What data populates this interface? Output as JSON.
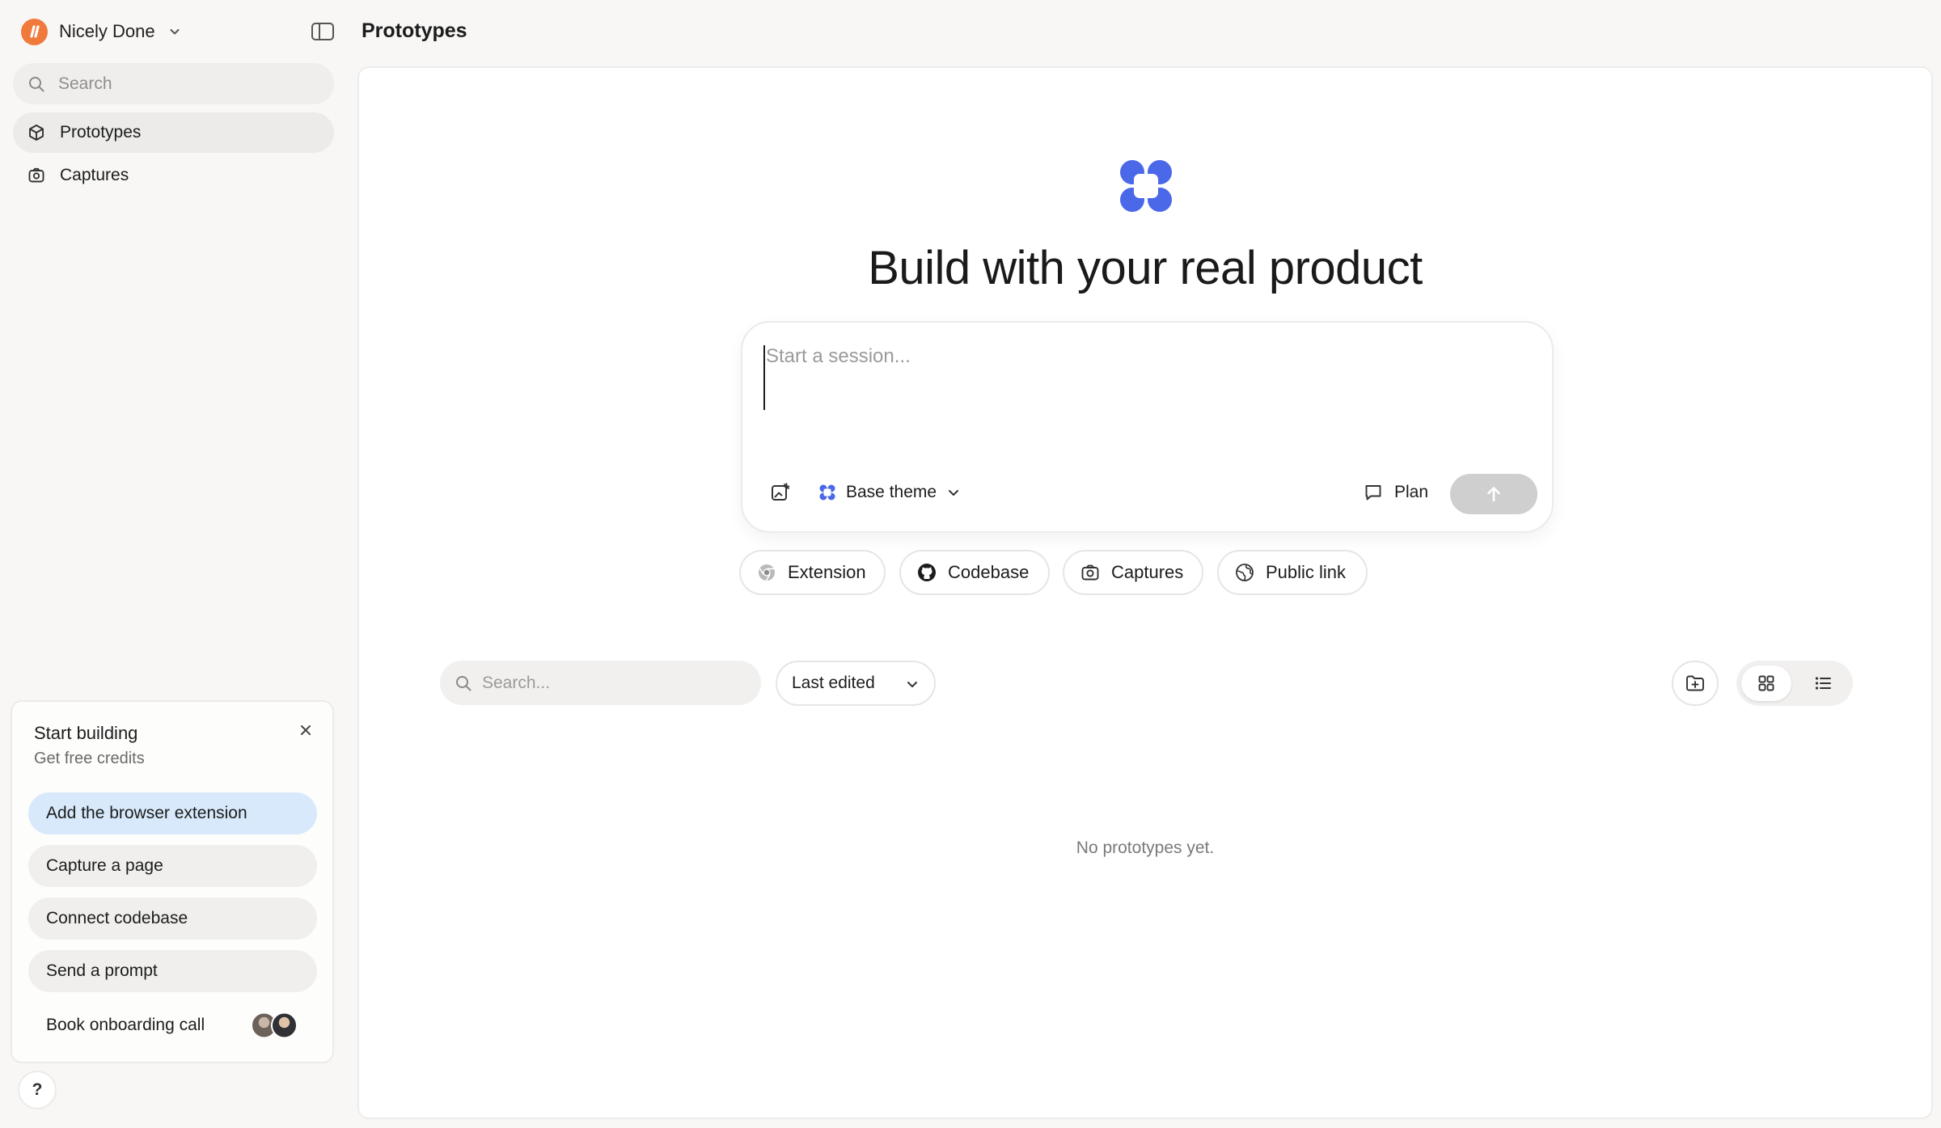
{
  "workspace": {
    "name": "Nicely Done",
    "logo_icon": "workspace-logo-icon",
    "brand_color": "#f07a3b"
  },
  "sidebar": {
    "search": {
      "placeholder": "Search"
    },
    "items": [
      {
        "label": "Prototypes",
        "icon": "cube-icon",
        "active": true
      },
      {
        "label": "Captures",
        "icon": "camera-icon",
        "active": false
      }
    ]
  },
  "onboarding": {
    "title": "Start building",
    "subtitle": "Get free credits",
    "steps": [
      {
        "label": "Add the browser extension"
      },
      {
        "label": "Capture a page"
      },
      {
        "label": "Connect codebase"
      },
      {
        "label": "Send a prompt"
      },
      {
        "label": "Book onboarding call"
      }
    ]
  },
  "help": {
    "label": "?"
  },
  "header": {
    "title": "Prototypes"
  },
  "main": {
    "hero_title": "Build with your real product",
    "brand_color": "#4a68e8",
    "composer": {
      "placeholder": "Start a session...",
      "theme_label": "Base theme",
      "plan_label": "Plan"
    },
    "chips": [
      {
        "label": "Extension",
        "icon": "chrome-icon"
      },
      {
        "label": "Codebase",
        "icon": "github-icon"
      },
      {
        "label": "Captures",
        "icon": "camera-icon"
      },
      {
        "label": "Public link",
        "icon": "globe-icon"
      }
    ],
    "list": {
      "search_placeholder": "Search...",
      "sort_label": "Last edited",
      "view_mode": "grid",
      "empty_text": "No prototypes yet."
    }
  }
}
